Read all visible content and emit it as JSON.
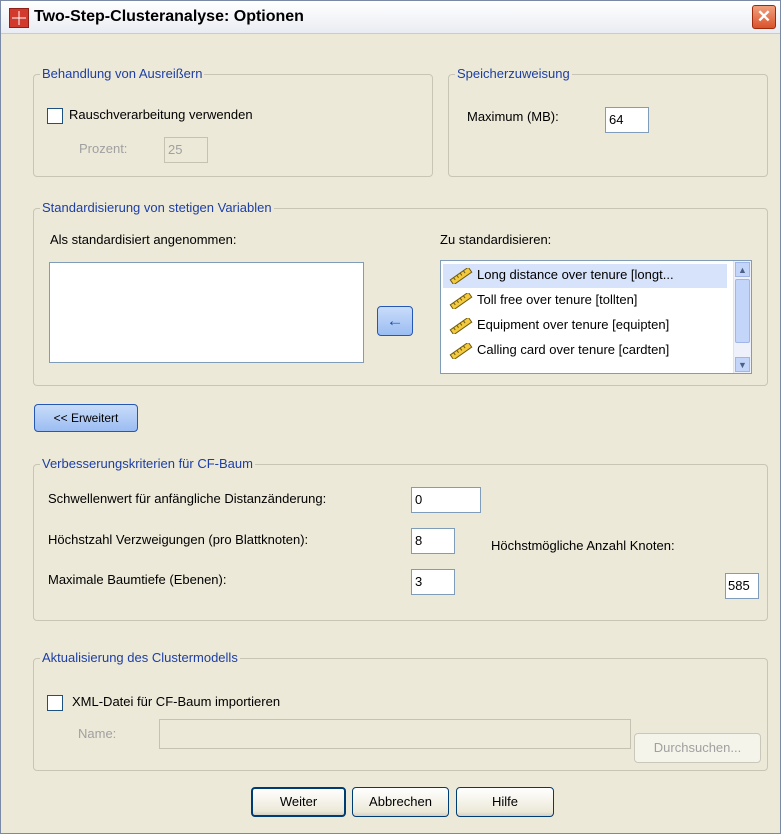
{
  "window": {
    "title": "Two-Step-Clusteranalyse: Optionen",
    "close_glyph": "✕"
  },
  "outliers": {
    "legend": "Behandlung von Ausreißern",
    "noise_checkbox_label": "Rauschverarbeitung verwenden",
    "noise_checked": false,
    "percent_label": "Prozent:",
    "percent_value": "25"
  },
  "memory": {
    "legend": "Speicherzuweisung",
    "max_label": "Maximum (MB):",
    "max_value": "64"
  },
  "standardize": {
    "legend": "Standardisierung von stetigen Variablen",
    "assumed_label": "Als standardisiert angenommen:",
    "assumed_items": [],
    "to_standardize_label": "Zu standardisieren:",
    "to_standardize_items": [
      {
        "label": "Long distance over tenure [longt...",
        "icon": "scale-ruler-icon",
        "selected": true
      },
      {
        "label": "Toll free over tenure [tollten]",
        "icon": "scale-ruler-icon",
        "selected": false
      },
      {
        "label": "Equipment over tenure [equipten]",
        "icon": "scale-ruler-icon",
        "selected": false
      },
      {
        "label": "Calling card over tenure [cardten]",
        "icon": "scale-ruler-icon",
        "selected": false
      }
    ],
    "move_arrow_glyph": "←"
  },
  "advanced_button": "<< Erweitert",
  "cf_tree": {
    "legend": "Verbesserungskriterien für CF-Baum",
    "threshold_label": "Schwellenwert für anfängliche Distanzänderung:",
    "threshold_value": "0",
    "max_branches_label": "Höchstzahl Verzweigungen (pro Blattknoten):",
    "max_branches_value": "8",
    "max_depth_label": "Maximale Baumtiefe (Ebenen):",
    "max_depth_value": "3",
    "max_nodes_label": "Höchstmögliche Anzahl Knoten:",
    "max_nodes_value": "585"
  },
  "model_update": {
    "legend": "Aktualisierung des Clustermodells",
    "import_checkbox_label": "XML-Datei für CF-Baum importieren",
    "import_checked": false,
    "name_label": "Name:",
    "name_value": "",
    "browse_button": "Durchsuchen..."
  },
  "footer": {
    "continue_button": "Weiter",
    "cancel_button": "Abbrechen",
    "help_button": "Hilfe"
  },
  "colors": {
    "dialog_bg": "#ece9d8",
    "legend_text": "#1d3ea6",
    "selection_bg": "#d7e3fb"
  }
}
